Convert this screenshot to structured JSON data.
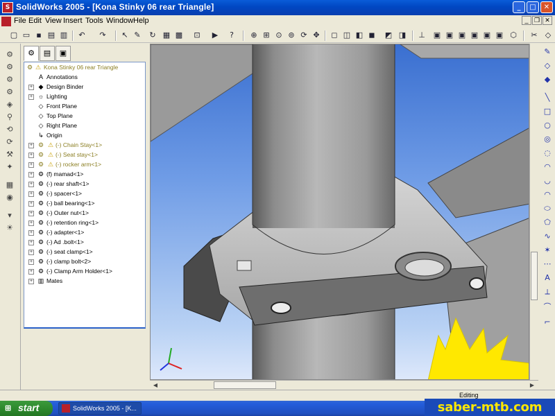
{
  "window": {
    "title": "SolidWorks 2005 - [Kona Stinky 06 rear Triangle]",
    "icon": "solidworks-logo-icon",
    "buttons": [
      "minimize",
      "maximize",
      "close"
    ]
  },
  "menu": {
    "items": [
      "File",
      "Edit",
      "View",
      "Insert",
      "Tools",
      "Window",
      "Help"
    ]
  },
  "toolbar": {
    "icons": [
      "new-icon",
      "open-icon",
      "save-icon",
      "print-icon",
      "print-preview-icon",
      "cut-icon",
      "copy-icon",
      "paste-icon",
      "undo-icon",
      "redo-icon",
      "select-icon",
      "sketch-icon",
      "rebuild-icon",
      "options-icon",
      "help-icon",
      "zoom-fit-icon",
      "zoom-area-icon",
      "zoom-in-icon",
      "zoom-selection-icon",
      "rotate-icon",
      "pan-icon",
      "wireframe-icon",
      "hidden-lines-icon",
      "hidden-removed-icon",
      "shaded-icon",
      "shadows-icon",
      "section-icon",
      "standard-views-icon",
      "front-view-icon",
      "back-view-icon",
      "left-view-icon",
      "right-view-icon",
      "top-view-icon",
      "bottom-view-icon",
      "isometric-icon"
    ]
  },
  "feature_manager": {
    "tabs": [
      "feature-tree-tab",
      "property-tab",
      "configuration-tab"
    ],
    "root": "Kona Stinky 06 rear Triangle",
    "nodes": [
      {
        "label": "Annotations",
        "icon": "annotations-icon",
        "expand": false,
        "warn": false
      },
      {
        "label": "Design Binder",
        "icon": "design-binder-icon",
        "expand": true,
        "warn": false
      },
      {
        "label": "Lighting",
        "icon": "lighting-icon",
        "expand": true,
        "warn": false
      },
      {
        "label": "Front Plane",
        "icon": "plane-icon",
        "expand": false,
        "warn": false
      },
      {
        "label": "Top Plane",
        "icon": "plane-icon",
        "expand": false,
        "warn": false
      },
      {
        "label": "Right Plane",
        "icon": "plane-icon",
        "expand": false,
        "warn": false
      },
      {
        "label": "Origin",
        "icon": "origin-icon",
        "expand": false,
        "warn": false
      },
      {
        "label": "(-) Chain Stay<1>",
        "icon": "part-icon",
        "expand": true,
        "warn": true
      },
      {
        "label": "(-) Seat stay<1>",
        "icon": "part-icon",
        "expand": true,
        "warn": true
      },
      {
        "label": "(-) rocker arm<1>",
        "icon": "part-icon",
        "expand": true,
        "warn": true
      },
      {
        "label": "(f) mamad<1>",
        "icon": "part-icon",
        "expand": true,
        "warn": false
      },
      {
        "label": "(-) rear shaft<1>",
        "icon": "part-icon",
        "expand": true,
        "warn": false
      },
      {
        "label": "(-) spacer<1>",
        "icon": "part-icon",
        "expand": true,
        "warn": false
      },
      {
        "label": "(-) ball bearing<1>",
        "icon": "part-icon",
        "expand": true,
        "warn": false
      },
      {
        "label": "(-) Outer nut<1>",
        "icon": "part-icon",
        "expand": true,
        "warn": false
      },
      {
        "label": "(-) retention ring<1>",
        "icon": "part-icon",
        "expand": true,
        "warn": false
      },
      {
        "label": "(-) adapter<1>",
        "icon": "part-icon",
        "expand": true,
        "warn": false
      },
      {
        "label": "(-) Ad .bolt<1>",
        "icon": "part-icon",
        "expand": true,
        "warn": false
      },
      {
        "label": "(-) seat clamp<1>",
        "icon": "part-icon",
        "expand": true,
        "warn": false
      },
      {
        "label": "(-) clamp bolt<2>",
        "icon": "part-icon",
        "expand": true,
        "warn": false
      },
      {
        "label": "(-) Clamp Arm Holder<1>",
        "icon": "part-icon",
        "expand": true,
        "warn": false
      },
      {
        "label": "Mates",
        "icon": "mates-icon",
        "expand": true,
        "warn": false
      }
    ]
  },
  "status_bar": {
    "text": "Editing"
  },
  "taskbar": {
    "start_label": "start",
    "task_label": "SolidWorks 2005 - [K..."
  },
  "watermark": {
    "text": "saber-mtb.com",
    "color": "#FFE800"
  },
  "colors": {
    "title_bar": "#0A5CD8",
    "tree_warning_text": "#8A7D20",
    "viewport_top": "#3A6FD0",
    "viewport_bottom": "#DDE8FB",
    "model_gray": "#9A9A9A"
  }
}
